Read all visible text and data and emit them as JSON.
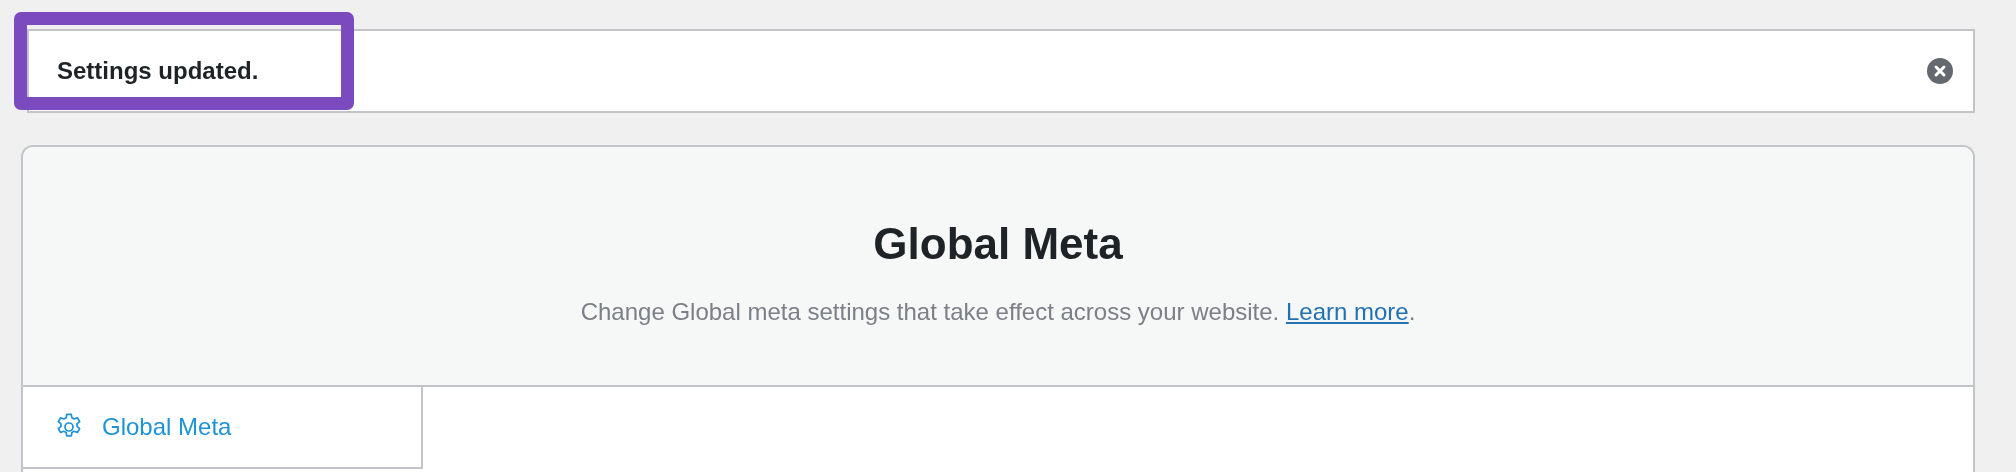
{
  "notice": {
    "message": "Settings updated.",
    "highlighted": true
  },
  "header": {
    "title": "Global Meta",
    "description": "Change Global meta settings that take effect across your website.",
    "link": "Learn more",
    "after_link": "."
  },
  "tabs": [
    {
      "label": "Global Meta",
      "selected": true
    }
  ]
}
